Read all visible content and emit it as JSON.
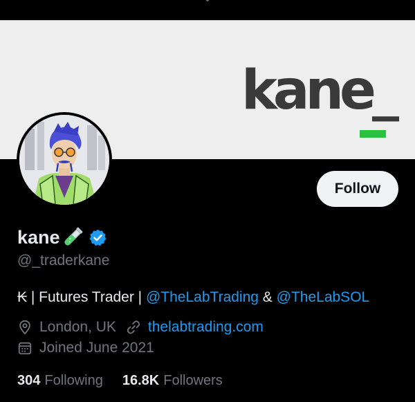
{
  "banner": {
    "logo_text": "kane_",
    "logo_bar_color": "#2cc23f"
  },
  "profile": {
    "display_name": "kane",
    "name_emoji": "test-tube-icon",
    "verified_icon": "verified-badge-icon",
    "handle": "@_traderkane",
    "follow_label": "Follow"
  },
  "bio": {
    "prefix": "₭ | Futures Trader | ",
    "mention_1": "@TheLabTrading",
    "separator": " & ",
    "mention_2": "@TheLabSOL"
  },
  "meta": {
    "location_icon": "location-pin-icon",
    "location": "London, UK",
    "link_icon": "link-icon",
    "website": "thelabtrading.com",
    "calendar_icon": "calendar-icon",
    "joined": "Joined June 2021"
  },
  "stats": {
    "following_count": "304",
    "following_label": "Following",
    "followers_count": "16.8K",
    "followers_label": "Followers"
  },
  "colors": {
    "background": "#000000",
    "text_primary": "#e7e9ea",
    "text_secondary": "#71767b",
    "accent_blue": "#1d9bf0",
    "follow_bg": "#eff3f4"
  }
}
